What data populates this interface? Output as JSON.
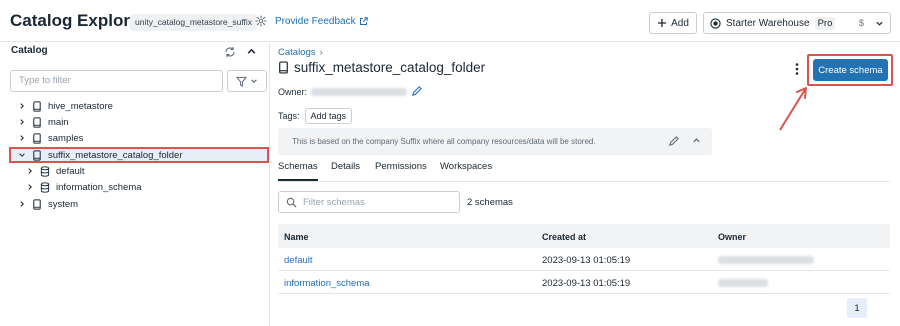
{
  "header": {
    "title": "Catalog Explorer",
    "metastore": "unity_catalog_metastore_suffix",
    "feedback_label": "Provide Feedback",
    "add_label": "Add",
    "warehouse_name": "Starter Warehouse",
    "warehouse_tier": "Pro",
    "warehouse_cost": "$"
  },
  "sidebar": {
    "title": "Catalog",
    "filter_placeholder": "Type to filter",
    "items": [
      {
        "label": "hive_metastore",
        "icon": "catalog-icon"
      },
      {
        "label": "main",
        "icon": "catalog-icon"
      },
      {
        "label": "samples",
        "icon": "catalog-icon"
      },
      {
        "label": "suffix_metastore_catalog_folder",
        "icon": "catalog-icon",
        "selected": true,
        "expanded": true
      },
      {
        "label": "default",
        "icon": "schema-icon"
      },
      {
        "label": "information_schema",
        "icon": "schema-icon"
      },
      {
        "label": "system",
        "icon": "catalog-icon"
      }
    ]
  },
  "main": {
    "breadcrumb": "Catalogs",
    "breadcrumb_sep": "›",
    "title": "suffix_metastore_catalog_folder",
    "create_label": "Create schema",
    "owner_label": "Owner:",
    "tags_label": "Tags:",
    "add_tags_label": "Add tags",
    "description": "This is based on the company Suffix where all company resources/data will be stored.",
    "tabs": [
      {
        "label": "Schemas",
        "active": true
      },
      {
        "label": "Details"
      },
      {
        "label": "Permissions"
      },
      {
        "label": "Workspaces"
      }
    ],
    "schema_filter_placeholder": "Filter schemas",
    "schema_count": "2 schemas",
    "table": {
      "columns": [
        "Name",
        "Created at",
        "Owner"
      ],
      "rows": [
        {
          "name": "default",
          "created": "2023-09-13 01:05:19"
        },
        {
          "name": "information_schema",
          "created": "2023-09-13 01:05:19"
        }
      ]
    },
    "page": "1"
  },
  "colors": {
    "accent": "#2272b4",
    "link": "#1f6fb5",
    "highlight": "#d9534f"
  }
}
